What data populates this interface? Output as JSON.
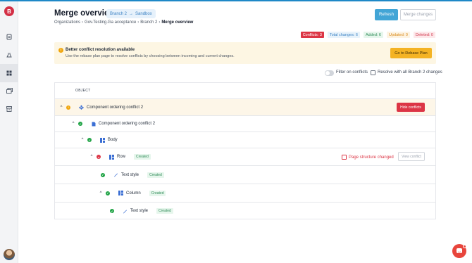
{
  "header": {
    "title": "Merge overview",
    "branch_from": "Branch 2",
    "branch_arrow": "→",
    "branch_to": "Sandbox",
    "breadcrumb": [
      "Organizations",
      "Gov.Testing.Ga acceptance",
      "Branch 2",
      "Merge overview"
    ],
    "refresh_label": "Refresh",
    "merge_label": "Merge changes"
  },
  "badges": {
    "conflicts": "Conflicts: 3",
    "total": "Total changes: 6",
    "added": "Added: 6",
    "updated": "Updated: 0",
    "deleted": "Deleted: 0"
  },
  "banner": {
    "title": "Better conflict resolution available",
    "text": "Use the rebase plan page to resolve conflicts by choosing between incoming and current changes.",
    "button": "Go to Rebase Plan"
  },
  "filters": {
    "filter_conflicts": "Filter on conflicts",
    "resolve_all": "Resolve with all Branch 2 changes"
  },
  "table": {
    "header": "OBJECT",
    "rows": [
      {
        "label": "Component ordering conflict 2",
        "status": "warning",
        "button": "Hide conflicts"
      },
      {
        "label": "Component ordering conflict 2",
        "status": "ok"
      },
      {
        "label": "Body",
        "status": "ok"
      },
      {
        "label": "Row",
        "status": "error",
        "tag": "Created",
        "conflict_label": "Page structure changed",
        "button": "View conflict"
      },
      {
        "label": "Text style",
        "status": "ok",
        "tag": "Created"
      },
      {
        "label": "Column",
        "status": "ok",
        "tag": "Created"
      },
      {
        "label": "Text style",
        "status": "ok",
        "tag": "Created"
      }
    ]
  },
  "sidebar": {
    "logo": "B",
    "icons": [
      "pages-icon",
      "flask-icon",
      "grid-icon",
      "images-icon",
      "archive-icon"
    ]
  },
  "colors": {
    "accent": "#42a5d6",
    "danger": "#dc3545",
    "warning": "#f4b324",
    "success": "#22a447"
  }
}
